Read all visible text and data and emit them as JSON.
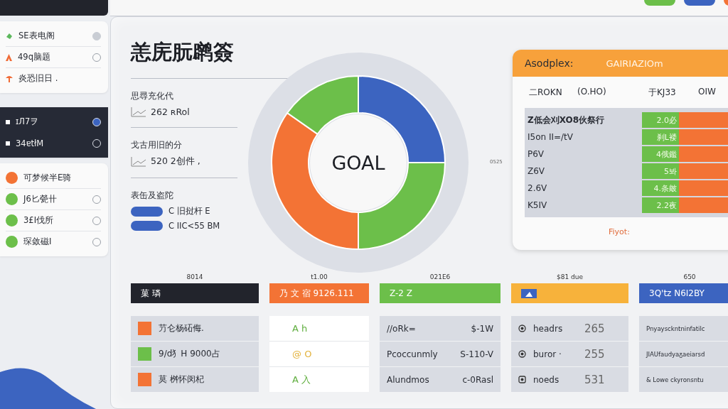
{
  "sidebar": {
    "groups": [
      {
        "kind": "icons",
        "highlighted": false,
        "items": [
          {
            "label": "SE表电阁",
            "color": "#5cb85c",
            "kind": "radio",
            "selected": true
          },
          {
            "label": "49q脑题",
            "color": "#f06a35",
            "kind": "radio",
            "selected": false
          },
          {
            "label": "炎恐旧日 .",
            "color": "#f06a35",
            "kind": "plain"
          }
        ]
      },
      {
        "kind": "bullets",
        "highlighted": true,
        "items": [
          {
            "label": "ɪЛ7ヲ",
            "kind": "radio",
            "selected": true
          },
          {
            "label": "34ɐtłM",
            "kind": "radio",
            "selected": false
          }
        ]
      },
      {
        "kind": "dots",
        "highlighted": false,
        "items": [
          {
            "label": "可梦候半E骑",
            "color": "#f37335",
            "kind": "plain"
          },
          {
            "label": "J6匕甇卄",
            "color": "#6cbf4a",
            "kind": "radio",
            "selected": false
          },
          {
            "label": "3£I伐所",
            "color": "#6cbf4a",
            "kind": "radio",
            "selected": false
          },
          {
            "label": "琛敛磁I",
            "color": "#6cbf4a",
            "kind": "radio",
            "selected": false
          }
        ]
      }
    ]
  },
  "title": "恙庑朊䴙簽",
  "stats": [
    {
      "label": "思尋充化代",
      "value": "262 ʀRol"
    },
    {
      "label": "戈古用旧的分",
      "value": "520 2创件 ,"
    }
  ],
  "legend": {
    "label": "表缶及盗陀",
    "items": [
      "C 旧挝杆 E",
      "C IIC<55 BM"
    ]
  },
  "donut": {
    "center_label": "GOAL",
    "tick_label": "0525"
  },
  "summary_card": {
    "title": "Asodplex:",
    "subtitle": "GAIRIAZIOm",
    "columns": [
      "二ROKN",
      "(O.HO)",
      "于KJ33",
      "OIW"
    ],
    "rows": [
      {
        "label": "Z低会刈XO8伙祭行",
        "value": "2.0必",
        "strong": true
      },
      {
        "label": "I5on II=/tV",
        "value": "刹L褛",
        "strong": false
      },
      {
        "label": "P6V",
        "value": "4俄鑑",
        "strong": false
      },
      {
        "label": "Z6V",
        "value": "5봐",
        "strong": false
      },
      {
        "label": "2.6V",
        "value": "4.条皴",
        "strong": false
      },
      {
        "label": "K5IV",
        "value": "2.2夜",
        "strong": false
      }
    ],
    "footer": "Fiyot:"
  },
  "columns": [
    {
      "caption": "8014",
      "header": "菓 璘",
      "color": "#22242c",
      "kind": "swatch",
      "rows": [
        {
          "text": "芀仑杨砳侮.",
          "color": "#f37335"
        },
        {
          "text": "9/d犭H 9000占",
          "color": "#6cbf4a"
        },
        {
          "text": "莫 桝怀闵杞",
          "color": "#f37335"
        }
      ]
    },
    {
      "caption": "t1.00",
      "header": "乃 文 宿 9126.111",
      "color": "#f37335",
      "kind": "glyph",
      "rows": [
        {
          "text": "A h",
          "color": "#5fae3e"
        },
        {
          "text": "@ O",
          "color": "#e3b23c"
        },
        {
          "text": "A 入",
          "color": "#5fae3e"
        }
      ]
    },
    {
      "caption": "021E6",
      "header": "Z-2 Z",
      "color": "#6cbf4a",
      "kind": "pair",
      "rows": [
        {
          "text": "//oRk=",
          "value": "$-1W"
        },
        {
          "text": "Pcoccunmly",
          "value": "S-110-V"
        },
        {
          "text": "Alundmos",
          "value": "c-0Rasl"
        }
      ]
    },
    {
      "caption": "$81 due",
      "color": "#f7b23b",
      "kind": "icon",
      "rows": [
        {
          "text": "headrs",
          "value": "265"
        },
        {
          "text": "buror ·",
          "value": "255"
        },
        {
          "text": "noeds",
          "value": "531"
        }
      ]
    },
    {
      "caption": "650",
      "header": "3Q'tz N6I2BY",
      "color": "#3c64c0",
      "kind": "text",
      "rows": [
        {
          "text": "Pnyaysckntninfatilc"
        },
        {
          "text": "JIAUfaudyaᵹaeiarsd"
        },
        {
          "text": "& Lowe ckyronsntu"
        }
      ]
    }
  ]
}
